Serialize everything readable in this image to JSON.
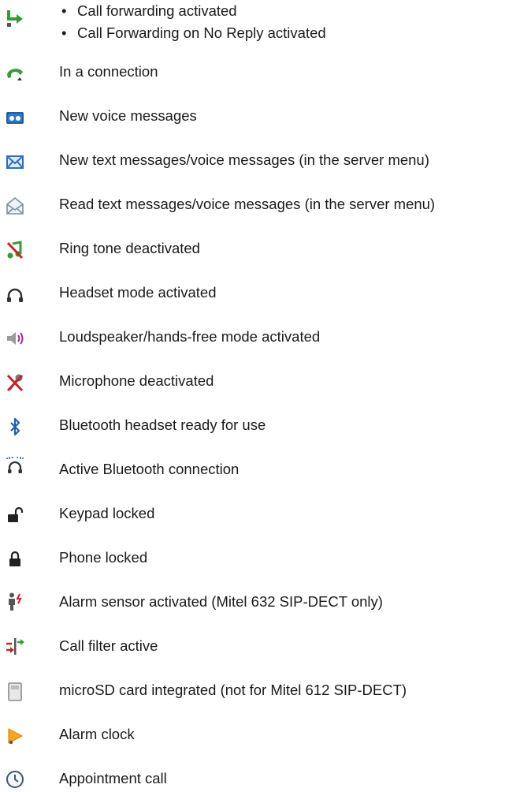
{
  "items": [
    {
      "icon": "call-forwarding-icon",
      "bullets": [
        "Call forwarding activated",
        "Call Forwarding on No Reply activated"
      ]
    },
    {
      "icon": "handset-icon",
      "label": "In a connection"
    },
    {
      "icon": "voicemail-icon",
      "label": "New voice messages"
    },
    {
      "icon": "closed-envelope-icon",
      "label": "New text messages/voice messages (in the server menu)"
    },
    {
      "icon": "open-envelope-icon",
      "label": "Read text messages/voice messages (in the server menu)"
    },
    {
      "icon": "ring-tone-off-icon",
      "label": "Ring tone deactivated"
    },
    {
      "icon": "headset-icon",
      "label": "Headset mode activated"
    },
    {
      "icon": "loudspeaker-icon",
      "label": "Loudspeaker/hands-free mode activated"
    },
    {
      "icon": "microphone-off-icon",
      "label": "Microphone deactivated"
    },
    {
      "icon": "bluetooth-icon",
      "label": "Bluetooth headset ready for use"
    },
    {
      "icon": "bluetooth-headset-active-icon",
      "label": "Active Bluetooth connection"
    },
    {
      "icon": "padlock-open-icon",
      "label": "Keypad locked"
    },
    {
      "icon": "padlock-closed-icon",
      "label": "Phone locked"
    },
    {
      "icon": "alarm-sensor-icon",
      "label": "Alarm sensor activated (Mitel 632 SIP-DECT only)"
    },
    {
      "icon": "call-filter-icon",
      "label": "Call filter active"
    },
    {
      "icon": "microsd-card-icon",
      "label": "microSD card integrated (not for Mitel 612 SIP-DECT)"
    },
    {
      "icon": "alarm-clock-bell-icon",
      "label": "Alarm clock"
    },
    {
      "icon": "appointment-clock-icon",
      "label": "Appointment call"
    }
  ]
}
